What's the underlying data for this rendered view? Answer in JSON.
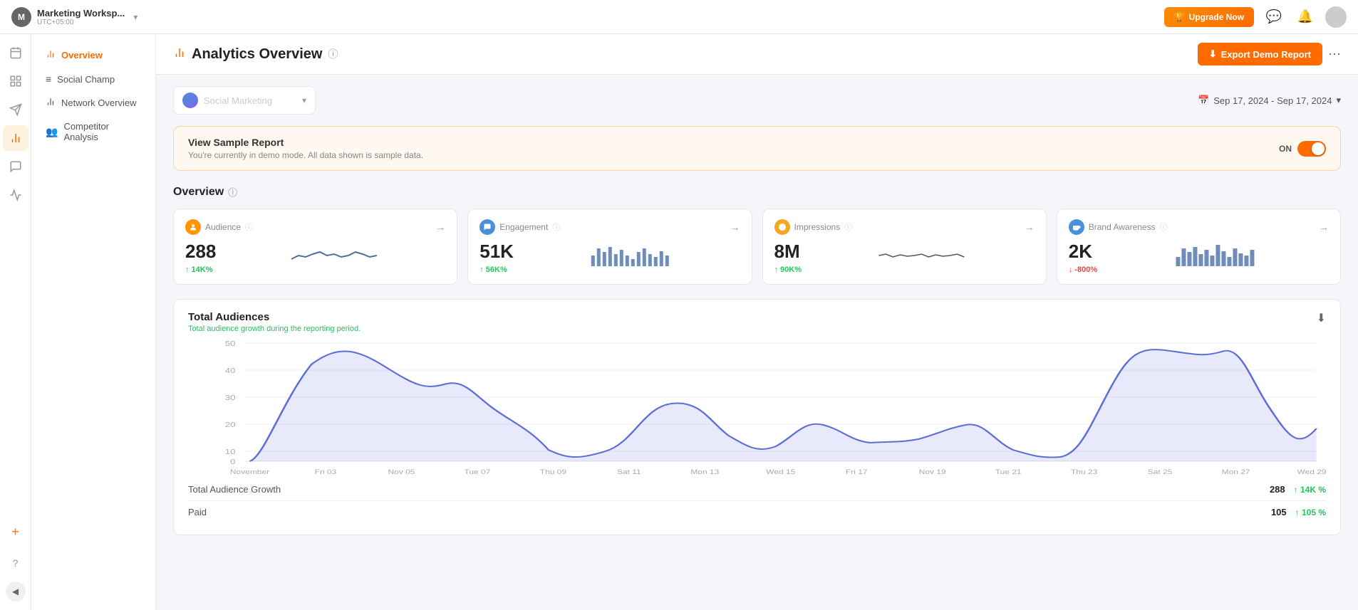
{
  "topbar": {
    "workspace": {
      "initial": "M",
      "name": "Marketing Worksp...",
      "timezone": "UTC+05:00"
    },
    "upgrade_label": "Upgrade Now",
    "icons": [
      "message-icon",
      "bell-icon",
      "avatar"
    ]
  },
  "icon_sidebar": {
    "items": [
      {
        "name": "calendar-icon",
        "glyph": "📅",
        "active": false
      },
      {
        "name": "grid-icon",
        "glyph": "⊞",
        "active": false
      },
      {
        "name": "send-icon",
        "glyph": "✈",
        "active": false
      },
      {
        "name": "analytics-icon",
        "glyph": "📊",
        "active": true
      },
      {
        "name": "comment-icon",
        "glyph": "💬",
        "active": false
      },
      {
        "name": "bars-icon",
        "glyph": "📈",
        "active": false
      }
    ]
  },
  "nav_sidebar": {
    "items": [
      {
        "name": "overview-nav",
        "label": "Overview",
        "icon": "📊",
        "active": true
      },
      {
        "name": "social-champ-nav",
        "label": "Social Champ",
        "icon": "≡",
        "active": false
      },
      {
        "name": "network-overview-nav",
        "label": "Network Overview",
        "icon": "📶",
        "active": false
      },
      {
        "name": "competitor-analysis-nav",
        "label": "Competitor Analysis",
        "icon": "👥",
        "active": false
      }
    ]
  },
  "header": {
    "title": "Analytics Overview",
    "help_label": "?",
    "export_label": "Export Demo Report",
    "more_label": "⋯"
  },
  "filter_bar": {
    "profile": {
      "name": "Social Marketing",
      "placeholder": "Social Marketing"
    },
    "date_range": "Sep 17, 2024 - Sep 17, 2024"
  },
  "demo_banner": {
    "title": "View Sample Report",
    "subtitle": "You're currently in demo mode. All data shown is sample data.",
    "toggle_label": "ON"
  },
  "overview": {
    "section_title": "Overview",
    "cards": [
      {
        "id": "audience",
        "title": "Audience",
        "value": "288",
        "change": "↑ 14K%",
        "change_dir": "up",
        "sparkline_color": "#4a6fa5"
      },
      {
        "id": "engagement",
        "title": "Engagement",
        "value": "51K",
        "change": "↑ 56K%",
        "change_dir": "up",
        "sparkline_color": "#4a6fa5"
      },
      {
        "id": "impressions",
        "title": "Impressions",
        "value": "8M",
        "change": "↑ 90K%",
        "change_dir": "up",
        "sparkline_color": "#555"
      },
      {
        "id": "brand-awareness",
        "title": "Brand Awareness",
        "value": "2K",
        "change": "↓ -800%",
        "change_dir": "down",
        "sparkline_color": "#4a6fa5"
      }
    ]
  },
  "total_audiences": {
    "title": "Total Audiences",
    "subtitle": "Total audience growth during the reporting period.",
    "x_labels": [
      "November",
      "Fri 03",
      "Nov 05",
      "Tue 07",
      "Thu 09",
      "Sat 11",
      "Mon 13",
      "Wed 15",
      "Fri 17",
      "Nov 19",
      "Tue 21",
      "Thu 23",
      "Sat 25",
      "Mon 27",
      "Wed 29"
    ],
    "y_labels": [
      "50",
      "40",
      "30",
      "20",
      "10",
      "0"
    ],
    "stats": [
      {
        "name": "Total Audience Growth",
        "value": "288",
        "change": "↑ 14K %",
        "dir": "up"
      },
      {
        "name": "Paid",
        "value": "105",
        "change": "↑ 105 %",
        "dir": "up"
      }
    ]
  }
}
